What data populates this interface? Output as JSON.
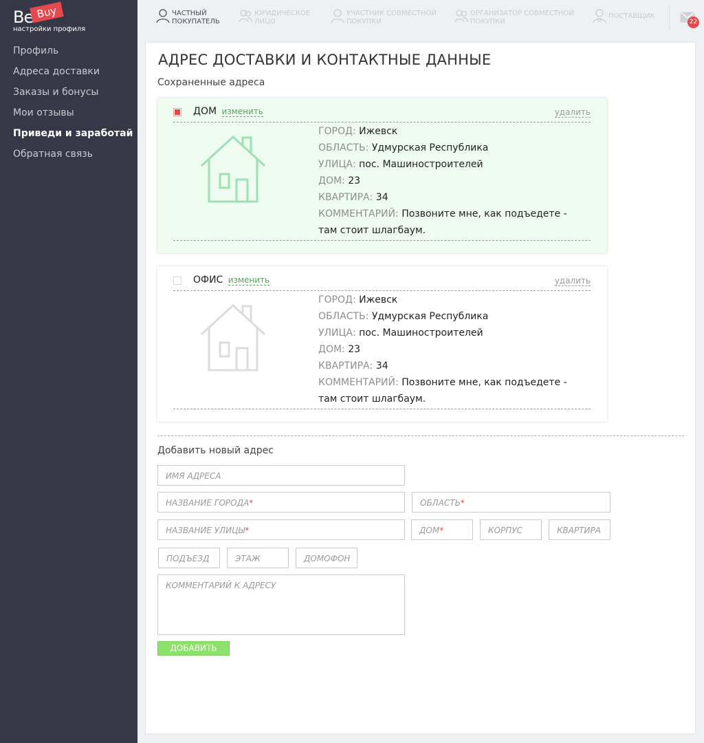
{
  "brand": {
    "logo_be": "Be",
    "logo_buy": "Buy",
    "subtitle": "настройки профиля"
  },
  "sidebar": {
    "items": [
      {
        "label": "Профиль",
        "active": false
      },
      {
        "label": "Адреса доставки",
        "active": false
      },
      {
        "label": "Заказы и бонусы",
        "active": false
      },
      {
        "label": "Мои отзывы",
        "active": false
      },
      {
        "label": "Приведи и заработай",
        "active": true
      },
      {
        "label": "Обратная связь",
        "active": false
      }
    ]
  },
  "topnav": {
    "tabs": [
      {
        "label": "ЧАСТНЫЙ\nПОКУПАТЕЛЬ",
        "icon": "person-icon",
        "active": true
      },
      {
        "label": "ЮРИДИЧЕСКОЕ\nЛИЦО",
        "icon": "group-icon",
        "active": false
      },
      {
        "label": "УЧАСТНИК СОВМЕСТНОЙ\nПОКУПКИ",
        "icon": "person-icon",
        "active": false
      },
      {
        "label": "ОРГАНИЗАТОР СОВМЕСТНОЙ\nПОКУПКИ",
        "icon": "group-icon",
        "active": false
      },
      {
        "label": "ПОСТАВЩИК",
        "icon": "person-badge-icon",
        "active": false
      }
    ],
    "messages_count": "22"
  },
  "main": {
    "title": "АДРЕС ДОСТАВКИ И КОНТАКТНЫЕ ДАННЫЕ",
    "saved_label": "Сохраненные адреса",
    "edit_label": "изменить",
    "delete_label": "удалить",
    "field_keys": {
      "city": "ГОРОД:",
      "region": "ОБЛАСТЬ:",
      "street": "УЛИЦА:",
      "house": "ДОМ:",
      "apartment": "КВАРТИРА:",
      "comment": "КОММЕНТАРИЙ:"
    },
    "addresses": [
      {
        "name": "ДОМ",
        "selected": true,
        "city": "Ижевск",
        "region": "Удмурская Республика",
        "street": "пос. Машиностроителей",
        "house": "23",
        "apartment": "34",
        "comment": "Позвоните мне, как подъедете - там стоит шлагбаум."
      },
      {
        "name": "ОФИС",
        "selected": false,
        "city": "Ижевск",
        "region": "Удмурская Республика",
        "street": "пос. Машиностроителей",
        "house": "23",
        "apartment": "34",
        "comment": "Позвоните мне, как подъедете - там стоит шлагбаум."
      }
    ],
    "colors": {
      "accent_green": "#8ee06c",
      "house_active": "#9fdfb4",
      "house_inactive": "#dcdcdc",
      "required": "#e5484d"
    }
  },
  "form": {
    "title": "Добавить новый адрес",
    "address_name": "ИМЯ АДРЕСА",
    "city": "НАЗВАНИЕ ГОРОДА",
    "region": "ОБЛАСТЬ",
    "street": "НАЗВАНИЕ УЛИЦЫ",
    "house": "ДОМ",
    "building": "КОРПУС",
    "apartment": "КВАРТИРА",
    "entrance": "ПОДЪЕЗД",
    "floor": "ЭТАЖ",
    "intercom": "ДОМОФОН",
    "comment": "КОММЕНТАРИЙ К АДРЕСУ",
    "required_mark": "*",
    "submit": "ДОБАВИТЬ"
  }
}
